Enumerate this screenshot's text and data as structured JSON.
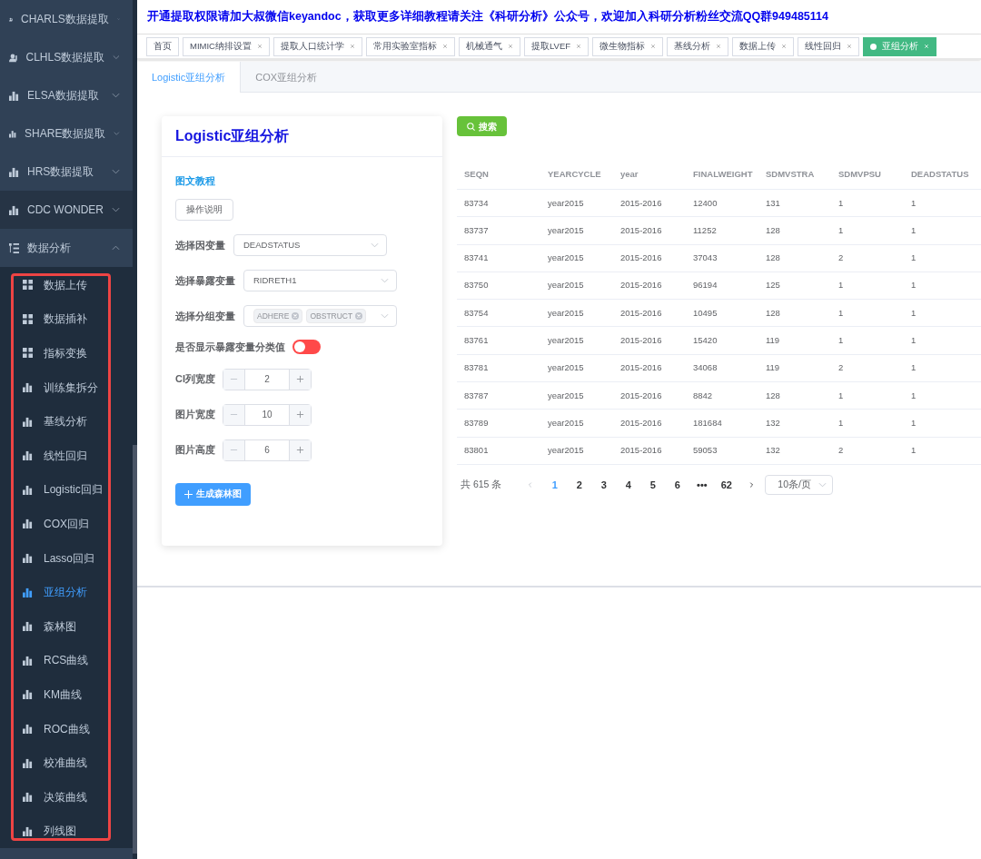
{
  "sidebar": {
    "items": [
      {
        "label": "CHARLS数据提取",
        "kind": "user",
        "highlighted": false,
        "expanded": false
      },
      {
        "label": "CLHLS数据提取",
        "kind": "user",
        "highlighted": false,
        "expanded": false
      },
      {
        "label": "ELSA数据提取",
        "kind": "chart",
        "highlighted": false,
        "expanded": false
      },
      {
        "label": "SHARE数据提取",
        "kind": "chart",
        "highlighted": false,
        "expanded": false
      },
      {
        "label": "HRS数据提取",
        "kind": "chart",
        "highlighted": false,
        "expanded": false
      },
      {
        "label": "CDC WONDER",
        "kind": "chart",
        "highlighted": true,
        "expanded": false
      },
      {
        "label": "数据分析",
        "kind": "tree",
        "highlighted": false,
        "expanded": true,
        "children": [
          {
            "label": "数据上传",
            "kind": "grid",
            "selected": false
          },
          {
            "label": "数据插补",
            "kind": "grid",
            "selected": false
          },
          {
            "label": "指标变换",
            "kind": "grid",
            "selected": false
          },
          {
            "label": "训练集拆分",
            "kind": "chart",
            "selected": false
          },
          {
            "label": "基线分析",
            "kind": "chart",
            "selected": false
          },
          {
            "label": "线性回归",
            "kind": "chart",
            "selected": false
          },
          {
            "label": "Logistic回归",
            "kind": "chart",
            "selected": false
          },
          {
            "label": "COX回归",
            "kind": "chart",
            "selected": false
          },
          {
            "label": "Lasso回归",
            "kind": "chart",
            "selected": false
          },
          {
            "label": "亚组分析",
            "kind": "chart",
            "selected": true
          },
          {
            "label": "森林图",
            "kind": "chart",
            "selected": false
          },
          {
            "label": "RCS曲线",
            "kind": "chart",
            "selected": false
          },
          {
            "label": "KM曲线",
            "kind": "chart",
            "selected": false
          },
          {
            "label": "ROC曲线",
            "kind": "chart",
            "selected": false
          },
          {
            "label": "校准曲线",
            "kind": "chart",
            "selected": false
          },
          {
            "label": "决策曲线",
            "kind": "chart",
            "selected": false
          },
          {
            "label": "列线图",
            "kind": "chart",
            "selected": false
          }
        ]
      }
    ],
    "annotation": {
      "kind": "outline",
      "color": "#ee4444"
    }
  },
  "notice": "开通提取权限请加大叔微信keyandoc，获取更多详细教程请关注《科研分析》公众号，欢迎加入科研分析粉丝交流QQ群949485114",
  "tag_bar": [
    {
      "label": "首页",
      "closable": false,
      "selected": false
    },
    {
      "label": "MIMIC纳排设置",
      "closable": true,
      "selected": false
    },
    {
      "label": "提取人口统计学",
      "closable": true,
      "selected": false
    },
    {
      "label": "常用实验室指标",
      "closable": true,
      "selected": false
    },
    {
      "label": "机械通气",
      "closable": true,
      "selected": false
    },
    {
      "label": "提取LVEF",
      "closable": true,
      "selected": false
    },
    {
      "label": "微生物指标",
      "closable": true,
      "selected": false
    },
    {
      "label": "基线分析",
      "closable": true,
      "selected": false
    },
    {
      "label": "数据上传",
      "closable": true,
      "selected": false
    },
    {
      "label": "线性回归",
      "closable": true,
      "selected": false
    },
    {
      "label": "亚组分析",
      "closable": true,
      "selected": true
    }
  ],
  "tabs": [
    {
      "label": "Logistic亚组分析",
      "selected": true
    },
    {
      "label": "COX亚组分析",
      "selected": false
    }
  ],
  "form_card": {
    "title": "Logistic亚组分析",
    "tutorial_link": "图文教程",
    "help_button": "操作说明",
    "selects": [
      {
        "label": "选择因变量",
        "value": "DEADSTATUS"
      },
      {
        "label": "选择暴露变量",
        "value": "RIDRETH1"
      },
      {
        "label": "选择分组变量",
        "tags": [
          "ADHERE",
          "OBSTRUCT"
        ]
      }
    ],
    "switch": {
      "label": "是否显示暴露变量分类值",
      "on": false
    },
    "steppers": [
      {
        "label": "CI列宽度",
        "value": "2"
      },
      {
        "label": "图片宽度",
        "value": "10"
      },
      {
        "label": "图片高度",
        "value": "6"
      }
    ],
    "submit_button": "生成森林图"
  },
  "search_button": "搜索",
  "table": {
    "columns": [
      "SEQN",
      "YEARCYCLE",
      "year",
      "FINALWEIGHT",
      "SDMVSTRA",
      "SDMVPSU",
      "DEADSTATUS"
    ],
    "rows": [
      [
        "83734",
        "year2015",
        "2015-2016",
        "12400",
        "131",
        "1",
        "1"
      ],
      [
        "83737",
        "year2015",
        "2015-2016",
        "11252",
        "128",
        "1",
        "1"
      ],
      [
        "83741",
        "year2015",
        "2015-2016",
        "37043",
        "128",
        "2",
        "1"
      ],
      [
        "83750",
        "year2015",
        "2015-2016",
        "96194",
        "125",
        "1",
        "1"
      ],
      [
        "83754",
        "year2015",
        "2015-2016",
        "10495",
        "128",
        "1",
        "1"
      ],
      [
        "83761",
        "year2015",
        "2015-2016",
        "15420",
        "119",
        "1",
        "1"
      ],
      [
        "83781",
        "year2015",
        "2015-2016",
        "34068",
        "119",
        "2",
        "1"
      ],
      [
        "83787",
        "year2015",
        "2015-2016",
        "8842",
        "128",
        "1",
        "1"
      ],
      [
        "83789",
        "year2015",
        "2015-2016",
        "181684",
        "132",
        "1",
        "1"
      ],
      [
        "83801",
        "year2015",
        "2015-2016",
        "59053",
        "132",
        "2",
        "1"
      ]
    ]
  },
  "pagination": {
    "total": "共 615 条",
    "pages": [
      {
        "label": "1",
        "selected": true
      },
      {
        "label": "2",
        "selected": false
      },
      {
        "label": "3",
        "selected": false
      },
      {
        "label": "4",
        "selected": false
      },
      {
        "label": "5",
        "selected": false
      },
      {
        "label": "6",
        "selected": false
      },
      {
        "label": "•••",
        "selected": false
      },
      {
        "label": "62",
        "selected": false
      }
    ],
    "page_size": "10条/页"
  }
}
